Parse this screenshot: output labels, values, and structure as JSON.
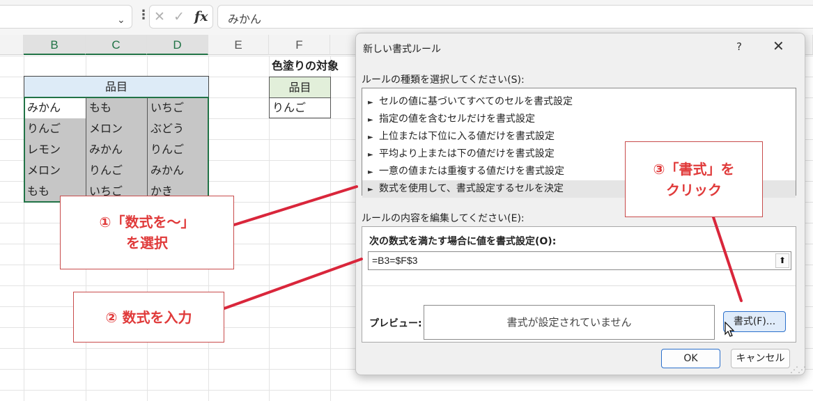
{
  "formula_bar": {
    "chevron": "⌄",
    "cancel_icon": "✕",
    "enter_icon": "✓",
    "fx_label": "fx",
    "content": "みかん"
  },
  "columns": [
    "B",
    "C",
    "D",
    "E",
    "F"
  ],
  "table": {
    "header": "品目",
    "rows": [
      [
        "みかん",
        "もも",
        "いちご"
      ],
      [
        "りんご",
        "メロン",
        "ぶどう"
      ],
      [
        "レモン",
        "みかん",
        "りんご"
      ],
      [
        "メロン",
        "りんご",
        "みかん"
      ],
      [
        "もも",
        "いちご",
        "かき"
      ]
    ]
  },
  "target": {
    "title": "色塗りの対象",
    "header": "品目",
    "value": "りんご"
  },
  "dialog": {
    "title": "新しい書式ルール",
    "help": "?",
    "close": "✕",
    "rule_type_label": "ルールの種類を選択してください(S):",
    "rules": [
      "セルの値に基づいてすべてのセルを書式設定",
      "指定の値を含むセルだけを書式設定",
      "上位または下位に入る値だけを書式設定",
      "平均より上または下の値だけを書式設定",
      "一意の値または重複する値だけを書式設定",
      "数式を使用して、書式設定するセルを決定"
    ],
    "edit_label": "ルールの内容を編集してください(E):",
    "formula_label": "次の数式を満たす場合に値を書式設定(O):",
    "formula_value": "=B3=$F$3",
    "preview_label": "プレビュー:",
    "preview_text": "書式が設定されていません",
    "format_button": "書式(F)...",
    "ok_button": "OK",
    "cancel_button": "キャンセル"
  },
  "callouts": {
    "step1_line1": "①「数式を～」",
    "step1_line2": "を選択",
    "step2": "② 数式を入力",
    "step3_line1": "③「書式」を",
    "step3_line2": "クリック"
  },
  "colors": {
    "accent_green": "#217346",
    "callout_red": "#e03a3a",
    "arrow_red": "#d9263b",
    "table_header_bg": "#ddebf7",
    "filled_cell_bg": "#c6c6c6"
  }
}
